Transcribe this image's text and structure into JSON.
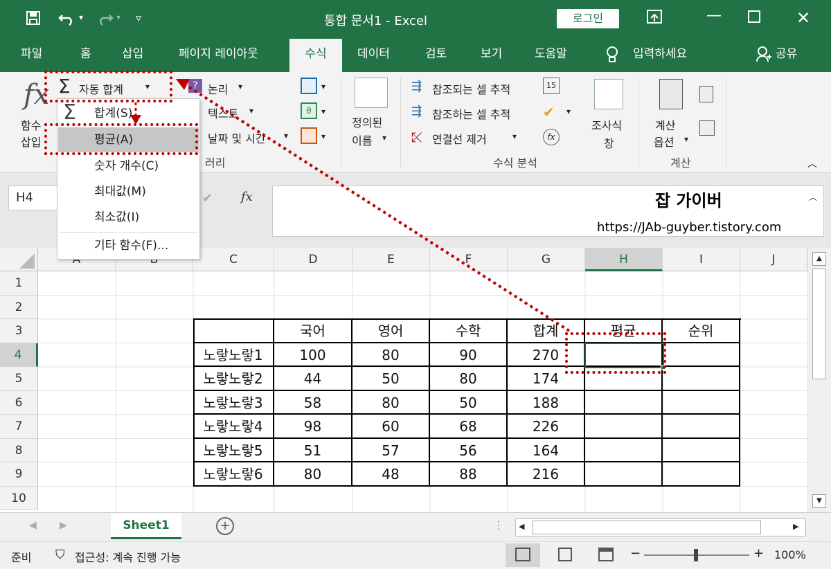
{
  "titlebar": {
    "title": "통합 문서1  -  Excel",
    "login_label": "로그인",
    "icons": [
      "save-icon",
      "undo-icon",
      "redo-icon",
      "customize-qat-icon",
      "ribbon-display-icon",
      "minimize-icon",
      "maximize-icon",
      "close-icon"
    ]
  },
  "tabs": [
    "파일",
    "홈",
    "삽입",
    "페이지 레이아웃",
    "수식",
    "데이터",
    "검토",
    "보기",
    "도움말"
  ],
  "active_tab": "수식",
  "tell_me": "입력하세요",
  "share": "공유",
  "ribbon": {
    "insert_function": [
      "함수",
      "삽입"
    ],
    "autosum": "자동 합계",
    "logical": "논리",
    "text": "텍스트",
    "datetime": "날짜 및 시간",
    "library_group_tail": "러리",
    "defined_names": [
      "정의된",
      "이름"
    ],
    "trace_precedents": "참조되는 셀 추적",
    "trace_dependents": "참조하는 셀 추적",
    "remove_arrows": "연결선 제거",
    "watch_window": [
      "조사식",
      "창"
    ],
    "formula_auditing_group": "수식 분석",
    "calc_options": [
      "계산",
      "옵션"
    ],
    "calc_group": "계산"
  },
  "autosum_menu": [
    {
      "label": "합계(S)"
    },
    {
      "label": "평균(A)",
      "highlighted": true
    },
    {
      "label": "숫자 개수(C)"
    },
    {
      "label": "최대값(M)"
    },
    {
      "label": "최소값(I)"
    },
    {
      "label": "기타 함수(F)..."
    }
  ],
  "namebox": "H4",
  "watermark": {
    "name": "잡 가이버",
    "url": "https://JAb-guyber.tistory.com"
  },
  "columns": [
    "A",
    "B",
    "C",
    "D",
    "E",
    "F",
    "G",
    "H",
    "I",
    "J"
  ],
  "rows": [
    "1",
    "2",
    "3",
    "4",
    "5",
    "6",
    "7",
    "8",
    "9",
    "10"
  ],
  "table": {
    "headers": [
      "국어",
      "영어",
      "수학",
      "합계",
      "평균",
      "순위"
    ],
    "rows": [
      {
        "name": "노랗노랗1",
        "values": [
          "100",
          "80",
          "90",
          "270"
        ]
      },
      {
        "name": "노랗노랗2",
        "values": [
          "44",
          "50",
          "80",
          "174"
        ]
      },
      {
        "name": "노랗노랗3",
        "values": [
          "58",
          "80",
          "50",
          "188"
        ]
      },
      {
        "name": "노랗노랗4",
        "values": [
          "98",
          "60",
          "68",
          "226"
        ]
      },
      {
        "name": "노랗노랗5",
        "values": [
          "51",
          "57",
          "56",
          "164"
        ]
      },
      {
        "name": "노랗노랗6",
        "values": [
          "80",
          "48",
          "88",
          "216"
        ]
      }
    ]
  },
  "sheet_tab": "Sheet1",
  "status": {
    "ready": "준비",
    "accessibility": "접근성: 계속 진행 가능",
    "zoom": "100%"
  }
}
